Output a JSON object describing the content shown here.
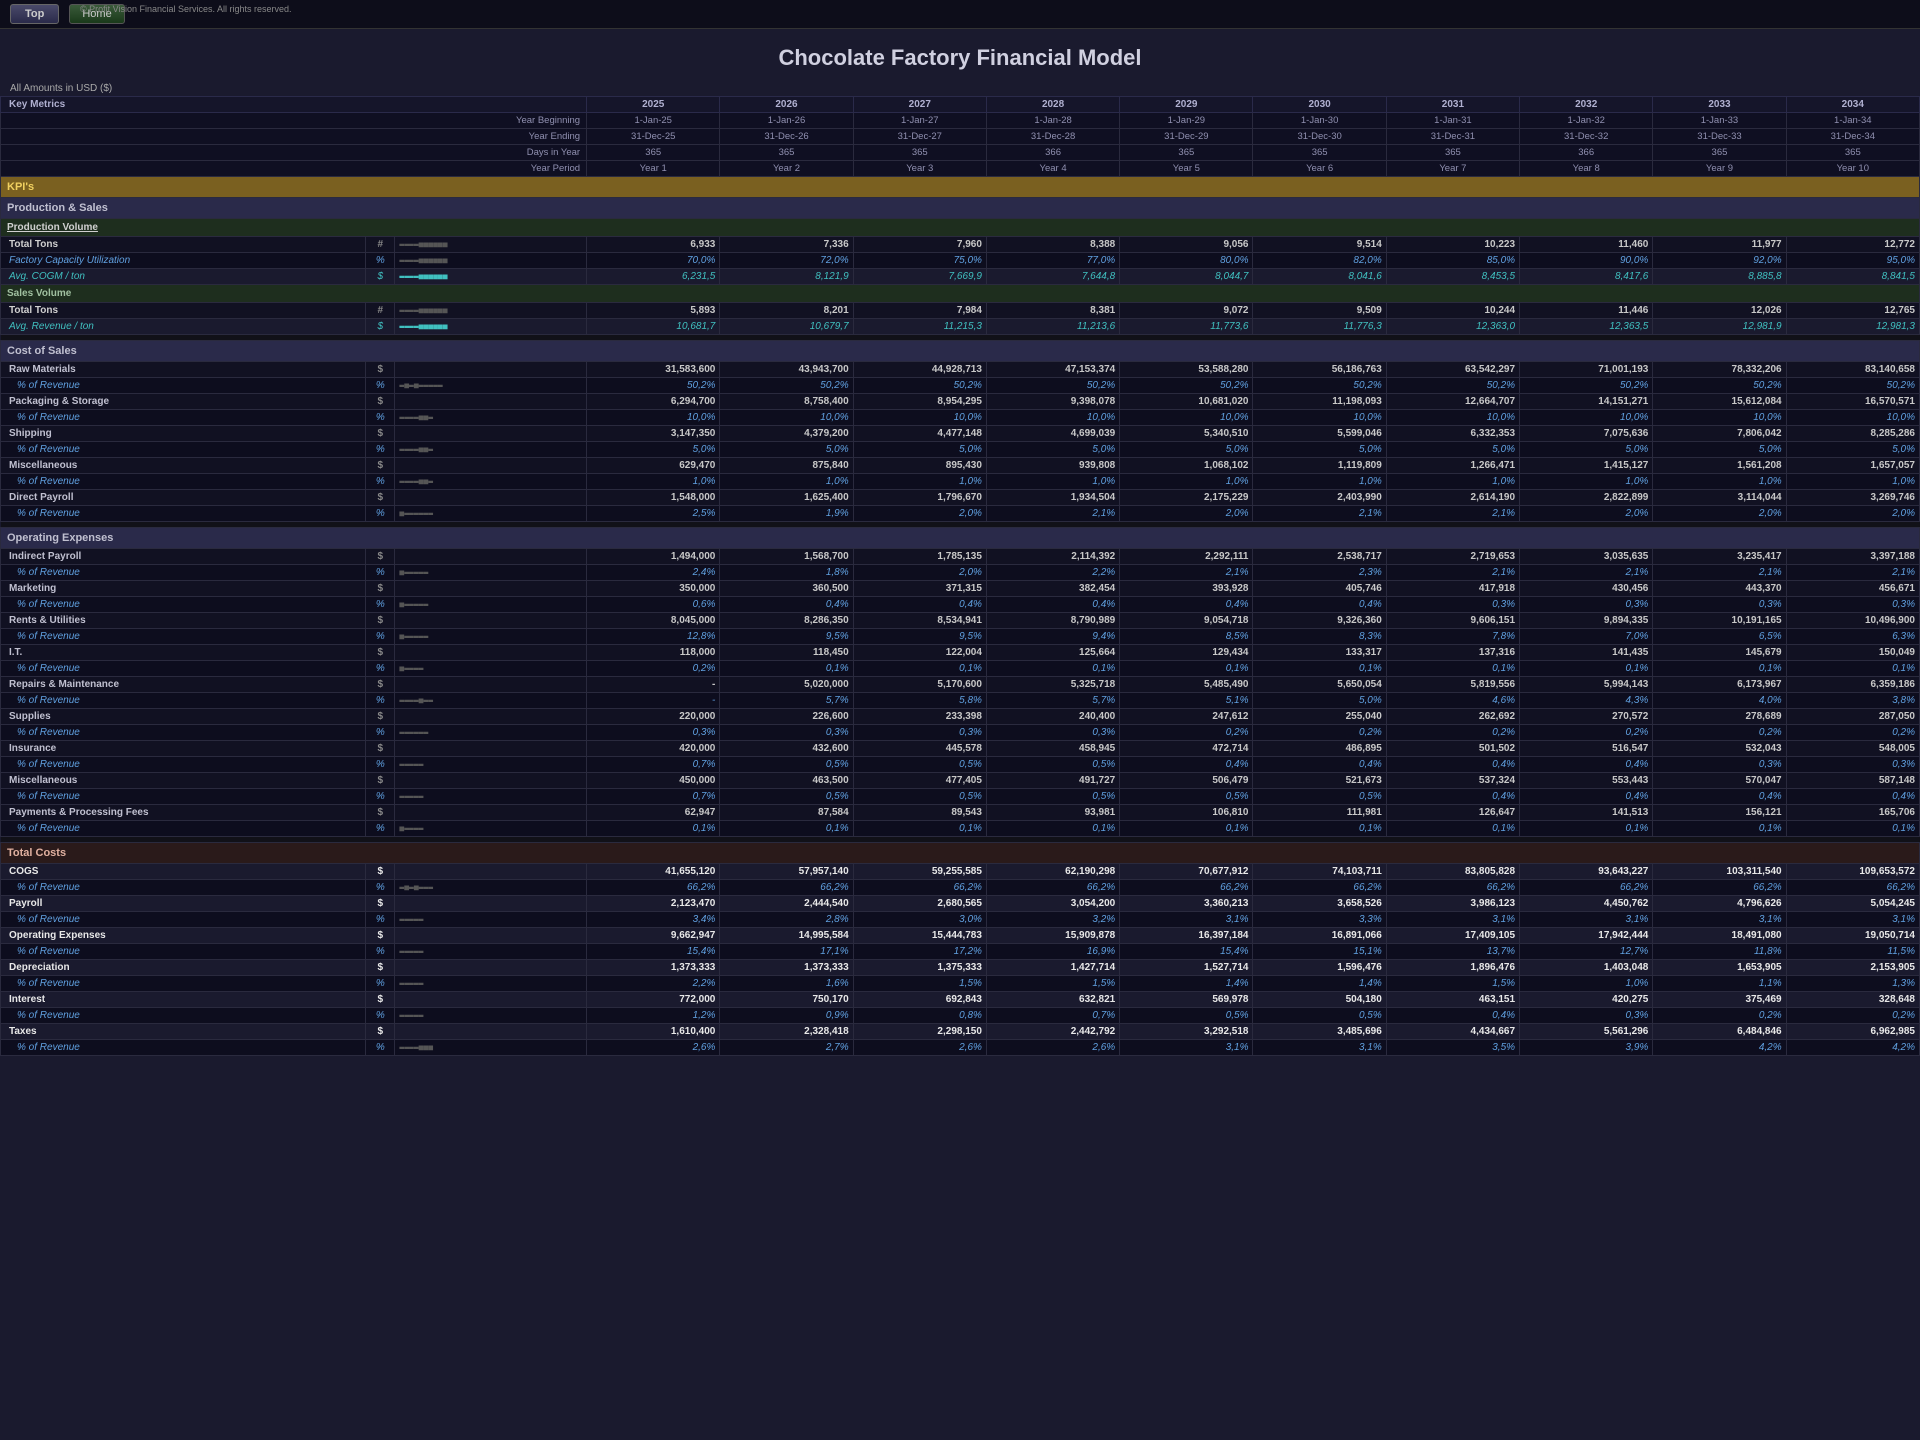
{
  "app": {
    "logo": "© Profit Vision Financial Services. All rights reserved.",
    "btn_top": "Top",
    "btn_home": "Home",
    "title": "Chocolate Factory Financial Model",
    "currency_note": "All Amounts in  USD ($)"
  },
  "columns": {
    "years": [
      "2025",
      "2026",
      "2027",
      "2028",
      "2029",
      "2030",
      "2031",
      "2032",
      "2033",
      "2034"
    ],
    "year_beginning": [
      "1-Jan-25",
      "1-Jan-26",
      "1-Jan-27",
      "1-Jan-28",
      "1-Jan-29",
      "1-Jan-30",
      "1-Jan-31",
      "1-Jan-32",
      "1-Jan-33",
      "1-Jan-34"
    ],
    "year_ending": [
      "31-Dec-25",
      "31-Dec-26",
      "31-Dec-27",
      "31-Dec-28",
      "31-Dec-29",
      "31-Dec-30",
      "31-Dec-31",
      "31-Dec-32",
      "31-Dec-33",
      "31-Dec-34"
    ],
    "days": [
      "365",
      "365",
      "365",
      "366",
      "365",
      "365",
      "365",
      "366",
      "365",
      "365"
    ],
    "periods": [
      "Year 1",
      "Year 2",
      "Year 3",
      "Year 4",
      "Year 5",
      "Year 6",
      "Year 7",
      "Year 8",
      "Year 9",
      "Year 10"
    ]
  },
  "sections": {
    "key_metrics": "Key Metrics",
    "kpis": "KPI's",
    "production_sales": "Production & Sales",
    "production_volume": "Production Volume",
    "cost_of_sales": "Cost of Sales",
    "operating_expenses": "Operating Expenses",
    "total_costs": "Total Costs"
  },
  "rows": {
    "total_tons_prod": {
      "label": "Total Tons",
      "unit": "#",
      "values": [
        "6,933",
        "7,336",
        "7,960",
        "8,388",
        "9,056",
        "9,514",
        "10,223",
        "11,460",
        "11,977",
        "12,772"
      ]
    },
    "factory_util": {
      "label": "Factory Capacity Utilization",
      "unit": "%",
      "values": [
        "70,0%",
        "72,0%",
        "75,0%",
        "77,0%",
        "80,0%",
        "82,0%",
        "85,0%",
        "90,0%",
        "92,0%",
        "95,0%"
      ]
    },
    "avg_cogm": {
      "label": "Avg. COGM / ton",
      "unit": "$",
      "values": [
        "6,231,5",
        "8,121,9",
        "7,669,9",
        "7,644,8",
        "8,044,7",
        "8,041,6",
        "8,453,5",
        "8,417,6",
        "8,885,8",
        "8,841,5"
      ]
    },
    "total_tons_sales": {
      "label": "Total Tons",
      "unit": "#",
      "values": [
        "5,893",
        "8,201",
        "7,984",
        "8,381",
        "9,072",
        "9,509",
        "10,244",
        "11,446",
        "12,026",
        "12,765"
      ]
    },
    "avg_rev_ton": {
      "label": "Avg. Revenue / ton",
      "unit": "$",
      "values": [
        "10,681,7",
        "10,679,7",
        "11,215,3",
        "11,213,6",
        "11,773,6",
        "11,776,3",
        "12,363,0",
        "12,363,5",
        "12,981,9",
        "12,981,3"
      ]
    },
    "raw_materials": {
      "label": "Raw Materials",
      "unit": "$",
      "values": [
        "31,583,600",
        "43,943,700",
        "44,928,713",
        "47,153,374",
        "53,588,280",
        "56,186,763",
        "63,542,297",
        "71,001,193",
        "78,332,206",
        "83,140,658"
      ]
    },
    "raw_pct": {
      "label": "% of Revenue",
      "unit": "%",
      "values": [
        "50,2%",
        "50,2%",
        "50,2%",
        "50,2%",
        "50,2%",
        "50,2%",
        "50,2%",
        "50,2%",
        "50,2%",
        "50,2%"
      ]
    },
    "packaging": {
      "label": "Packaging & Storage",
      "unit": "$",
      "values": [
        "6,294,700",
        "8,758,400",
        "8,954,295",
        "9,398,078",
        "10,681,020",
        "11,198,093",
        "12,664,707",
        "14,151,271",
        "15,612,084",
        "16,570,571"
      ]
    },
    "packaging_pct": {
      "label": "% of Revenue",
      "unit": "%",
      "values": [
        "10,0%",
        "10,0%",
        "10,0%",
        "10,0%",
        "10,0%",
        "10,0%",
        "10,0%",
        "10,0%",
        "10,0%",
        "10,0%"
      ]
    },
    "shipping": {
      "label": "Shipping",
      "unit": "$",
      "values": [
        "3,147,350",
        "4,379,200",
        "4,477,148",
        "4,699,039",
        "5,340,510",
        "5,599,046",
        "6,332,353",
        "7,075,636",
        "7,806,042",
        "8,285,286"
      ]
    },
    "shipping_pct": {
      "label": "% of Revenue",
      "unit": "%",
      "values": [
        "5,0%",
        "5,0%",
        "5,0%",
        "5,0%",
        "5,0%",
        "5,0%",
        "5,0%",
        "5,0%",
        "5,0%",
        "5,0%"
      ]
    },
    "misc_cos": {
      "label": "Miscellaneous",
      "unit": "$",
      "values": [
        "629,470",
        "875,840",
        "895,430",
        "939,808",
        "1,068,102",
        "1,119,809",
        "1,266,471",
        "1,415,127",
        "1,561,208",
        "1,657,057"
      ]
    },
    "misc_cos_pct": {
      "label": "% of Revenue",
      "unit": "%",
      "values": [
        "1,0%",
        "1,0%",
        "1,0%",
        "1,0%",
        "1,0%",
        "1,0%",
        "1,0%",
        "1,0%",
        "1,0%",
        "1,0%"
      ]
    },
    "direct_payroll": {
      "label": "Direct Payroll",
      "unit": "$",
      "values": [
        "1,548,000",
        "1,625,400",
        "1,796,670",
        "1,934,504",
        "2,175,229",
        "2,403,990",
        "2,614,190",
        "2,822,899",
        "3,114,044",
        "3,269,746"
      ]
    },
    "direct_payroll_pct": {
      "label": "% of Revenue",
      "unit": "%",
      "values": [
        "2,5%",
        "1,9%",
        "2,0%",
        "2,1%",
        "2,0%",
        "2,1%",
        "2,1%",
        "2,0%",
        "2,0%",
        "2,0%"
      ]
    },
    "indirect_payroll": {
      "label": "Indirect Payroll",
      "unit": "$",
      "values": [
        "1,494,000",
        "1,568,700",
        "1,785,135",
        "2,114,392",
        "2,292,111",
        "2,538,717",
        "2,719,653",
        "3,035,635",
        "3,235,417",
        "3,397,188"
      ]
    },
    "indirect_pct": {
      "label": "% of Revenue",
      "unit": "%",
      "values": [
        "2,4%",
        "1,8%",
        "2,0%",
        "2,2%",
        "2,1%",
        "2,3%",
        "2,1%",
        "2,1%",
        "2,1%",
        "2,1%"
      ]
    },
    "marketing": {
      "label": "Marketing",
      "unit": "$",
      "values": [
        "350,000",
        "360,500",
        "371,315",
        "382,454",
        "393,928",
        "405,746",
        "417,918",
        "430,456",
        "443,370",
        "456,671"
      ]
    },
    "marketing_pct": {
      "label": "% of Revenue",
      "unit": "%",
      "values": [
        "0,6%",
        "0,4%",
        "0,4%",
        "0,4%",
        "0,4%",
        "0,4%",
        "0,3%",
        "0,3%",
        "0,3%",
        "0,3%"
      ]
    },
    "rents": {
      "label": "Rents & Utilities",
      "unit": "$",
      "values": [
        "8,045,000",
        "8,286,350",
        "8,534,941",
        "8,790,989",
        "9,054,718",
        "9,326,360",
        "9,606,151",
        "9,894,335",
        "10,191,165",
        "10,496,900"
      ]
    },
    "rents_pct": {
      "label": "% of Revenue",
      "unit": "%",
      "values": [
        "12,8%",
        "9,5%",
        "9,5%",
        "9,4%",
        "8,5%",
        "8,3%",
        "7,8%",
        "7,0%",
        "6,5%",
        "6,3%"
      ]
    },
    "it": {
      "label": "I.T.",
      "unit": "$",
      "values": [
        "118,000",
        "118,450",
        "122,004",
        "125,664",
        "129,434",
        "133,317",
        "137,316",
        "141,435",
        "145,679",
        "150,049"
      ]
    },
    "it_pct": {
      "label": "% of Revenue",
      "unit": "%",
      "values": [
        "0,2%",
        "0,1%",
        "0,1%",
        "0,1%",
        "0,1%",
        "0,1%",
        "0,1%",
        "0,1%",
        "0,1%",
        "0,1%"
      ]
    },
    "repairs": {
      "label": "Repairs & Maintenance",
      "unit": "$",
      "values": [
        "-",
        "5,020,000",
        "5,170,600",
        "5,325,718",
        "5,485,490",
        "5,650,054",
        "5,819,556",
        "5,994,143",
        "6,173,967",
        "6,359,186"
      ]
    },
    "repairs_pct": {
      "label": "% of Revenue",
      "unit": "%",
      "values": [
        "-",
        "5,7%",
        "5,8%",
        "5,7%",
        "5,1%",
        "5,0%",
        "4,6%",
        "4,3%",
        "4,0%",
        "3,8%"
      ]
    },
    "supplies": {
      "label": "Supplies",
      "unit": "$",
      "values": [
        "220,000",
        "226,600",
        "233,398",
        "240,400",
        "247,612",
        "255,040",
        "262,692",
        "270,572",
        "278,689",
        "287,050"
      ]
    },
    "supplies_pct": {
      "label": "% of Revenue",
      "unit": "%",
      "values": [
        "0,3%",
        "0,3%",
        "0,3%",
        "0,3%",
        "0,2%",
        "0,2%",
        "0,2%",
        "0,2%",
        "0,2%",
        "0,2%"
      ]
    },
    "insurance": {
      "label": "Insurance",
      "unit": "$",
      "values": [
        "420,000",
        "432,600",
        "445,578",
        "458,945",
        "472,714",
        "486,895",
        "501,502",
        "516,547",
        "532,043",
        "548,005"
      ]
    },
    "insurance_pct": {
      "label": "% of Revenue",
      "unit": "%",
      "values": [
        "0,7%",
        "0,5%",
        "0,5%",
        "0,5%",
        "0,4%",
        "0,4%",
        "0,4%",
        "0,4%",
        "0,3%",
        "0,3%"
      ]
    },
    "misc_opex": {
      "label": "Miscellaneous",
      "unit": "$",
      "values": [
        "450,000",
        "463,500",
        "477,405",
        "491,727",
        "506,479",
        "521,673",
        "537,324",
        "553,443",
        "570,047",
        "587,148"
      ]
    },
    "misc_opex_pct": {
      "label": "% of Revenue",
      "unit": "%",
      "values": [
        "0,7%",
        "0,5%",
        "0,5%",
        "0,5%",
        "0,5%",
        "0,5%",
        "0,4%",
        "0,4%",
        "0,4%",
        "0,4%"
      ]
    },
    "payments": {
      "label": "Payments & Processing Fees",
      "unit": "$",
      "values": [
        "62,947",
        "87,584",
        "89,543",
        "93,981",
        "106,810",
        "111,981",
        "126,647",
        "141,513",
        "156,121",
        "165,706"
      ]
    },
    "payments_pct": {
      "label": "% of Revenue",
      "unit": "%",
      "values": [
        "0,1%",
        "0,1%",
        "0,1%",
        "0,1%",
        "0,1%",
        "0,1%",
        "0,1%",
        "0,1%",
        "0,1%",
        "0,1%"
      ]
    },
    "cogs": {
      "label": "COGS",
      "unit": "$",
      "values": [
        "41,655,120",
        "57,957,140",
        "59,255,585",
        "62,190,298",
        "70,677,912",
        "74,103,711",
        "83,805,828",
        "93,643,227",
        "103,311,540",
        "109,653,572"
      ]
    },
    "cogs_pct": {
      "label": "% of Revenue",
      "unit": "%",
      "values": [
        "66,2%",
        "66,2%",
        "66,2%",
        "66,2%",
        "66,2%",
        "66,2%",
        "66,2%",
        "66,2%",
        "66,2%",
        "66,2%"
      ]
    },
    "payroll_total": {
      "label": "Payroll",
      "unit": "$",
      "values": [
        "2,123,470",
        "2,444,540",
        "2,680,565",
        "3,054,200",
        "3,360,213",
        "3,658,526",
        "3,986,123",
        "4,450,762",
        "4,796,626",
        "5,054,245"
      ]
    },
    "payroll_pct": {
      "label": "% of Revenue",
      "unit": "%",
      "values": [
        "3,4%",
        "2,8%",
        "3,0%",
        "3,2%",
        "3,1%",
        "3,3%",
        "3,1%",
        "3,1%",
        "3,1%",
        "3,1%"
      ]
    },
    "opex_total": {
      "label": "Operating Expenses",
      "unit": "$",
      "values": [
        "9,662,947",
        "14,995,584",
        "15,444,783",
        "15,909,878",
        "16,397,184",
        "16,891,066",
        "17,409,105",
        "17,942,444",
        "18,491,080",
        "19,050,714"
      ]
    },
    "opex_pct": {
      "label": "% of Revenue",
      "unit": "%",
      "values": [
        "15,4%",
        "17,1%",
        "17,2%",
        "16,9%",
        "15,4%",
        "15,1%",
        "13,7%",
        "12,7%",
        "11,8%",
        "11,5%"
      ]
    },
    "depreciation": {
      "label": "Depreciation",
      "unit": "$",
      "values": [
        "1,373,333",
        "1,373,333",
        "1,375,333",
        "1,427,714",
        "1,527,714",
        "1,596,476",
        "1,896,476",
        "1,403,048",
        "1,653,905",
        "2,153,905"
      ]
    },
    "depr_pct": {
      "label": "% of Revenue",
      "unit": "%",
      "values": [
        "2,2%",
        "1,6%",
        "1,5%",
        "1,5%",
        "1,4%",
        "1,4%",
        "1,5%",
        "1,0%",
        "1,1%",
        "1,3%"
      ]
    },
    "interest": {
      "label": "Interest",
      "unit": "$",
      "values": [
        "772,000",
        "750,170",
        "692,843",
        "632,821",
        "569,978",
        "504,180",
        "463,151",
        "420,275",
        "375,469",
        "328,648"
      ]
    },
    "interest_pct": {
      "label": "% of Revenue",
      "unit": "%",
      "values": [
        "1,2%",
        "0,9%",
        "0,8%",
        "0,7%",
        "0,5%",
        "0,5%",
        "0,4%",
        "0,3%",
        "0,2%",
        "0,2%"
      ]
    },
    "taxes": {
      "label": "Taxes",
      "unit": "$",
      "values": [
        "1,610,400",
        "2,328,418",
        "2,298,150",
        "2,442,792",
        "3,292,518",
        "3,485,696",
        "4,434,667",
        "5,561,296",
        "6,484,846",
        "6,962,985"
      ]
    },
    "taxes_pct": {
      "label": "% of Revenue",
      "unit": "%",
      "values": [
        "2,6%",
        "2,7%",
        "2,6%",
        "2,6%",
        "3,1%",
        "3,1%",
        "3,5%",
        "3,9%",
        "4,2%",
        "4,2%"
      ]
    },
    "sales_volume": "Sales Volume"
  }
}
